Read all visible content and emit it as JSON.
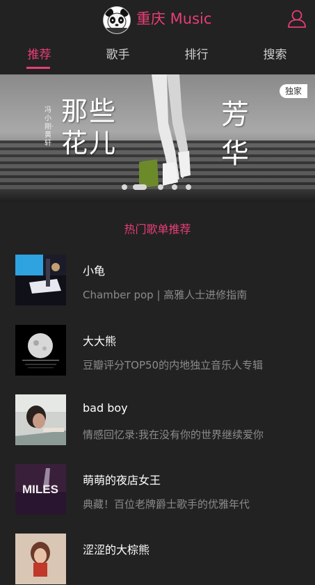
{
  "header": {
    "app_title": "重庆 Music",
    "logo_icon": "panda-logo-icon",
    "user_icon": "user-icon",
    "accent": "#e83e74"
  },
  "tabs": [
    {
      "label": "推荐",
      "active": true
    },
    {
      "label": "歌手",
      "active": false
    },
    {
      "label": "排行",
      "active": false
    },
    {
      "label": "搜索",
      "active": false
    }
  ],
  "banner": {
    "title_left": "那些花儿",
    "artist_left": "冯小刚·黄轩",
    "title_right": "芳华",
    "badge": "独家",
    "slide_count": 5,
    "active_slide": 2
  },
  "section_title": "热门歌单推荐",
  "playlists": [
    {
      "title": "小龟",
      "desc": "Chamber pop | 高雅人士进修指南"
    },
    {
      "title": "大大熊",
      "desc": "豆瓣评分TOP50的内地独立音乐人专辑"
    },
    {
      "title": "bad boy",
      "desc": "情感回忆录:我在没有你的世界继续爱你"
    },
    {
      "title": "萌萌的夜店女王",
      "desc": "典藏！百位老牌爵士歌手的优雅年代",
      "cover_text": "MILES"
    },
    {
      "title": "涩涩的大棕熊",
      "desc": ""
    }
  ]
}
